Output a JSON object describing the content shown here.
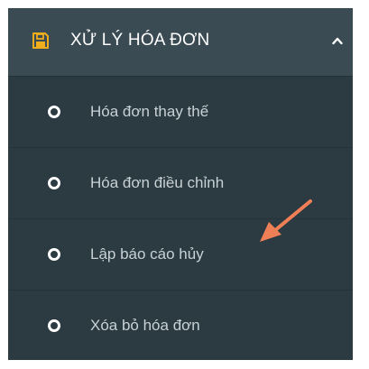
{
  "menu": {
    "header": {
      "title": "XỬ LÝ HÓA ĐƠN",
      "icon": "floppy-disk-icon",
      "toggle_icon": "chevron-up-icon",
      "icon_color": "#f0ad1c"
    },
    "items": [
      {
        "label": "Hóa đơn thay thế",
        "icon": "circle-outline-icon"
      },
      {
        "label": "Hóa đơn điều chỉnh",
        "icon": "circle-outline-icon"
      },
      {
        "label": "Lập báo cáo hủy",
        "icon": "circle-outline-icon"
      },
      {
        "label": "Xóa bỏ hóa đơn",
        "icon": "circle-outline-icon"
      }
    ]
  },
  "annotation": {
    "type": "arrow",
    "color": "#ef7f56",
    "points_to": "Lập báo cáo hủy"
  },
  "colors": {
    "sidebar_bg": "#2c3b41",
    "header_bg": "#3a4b54",
    "item_text": "#c7d1d6"
  }
}
